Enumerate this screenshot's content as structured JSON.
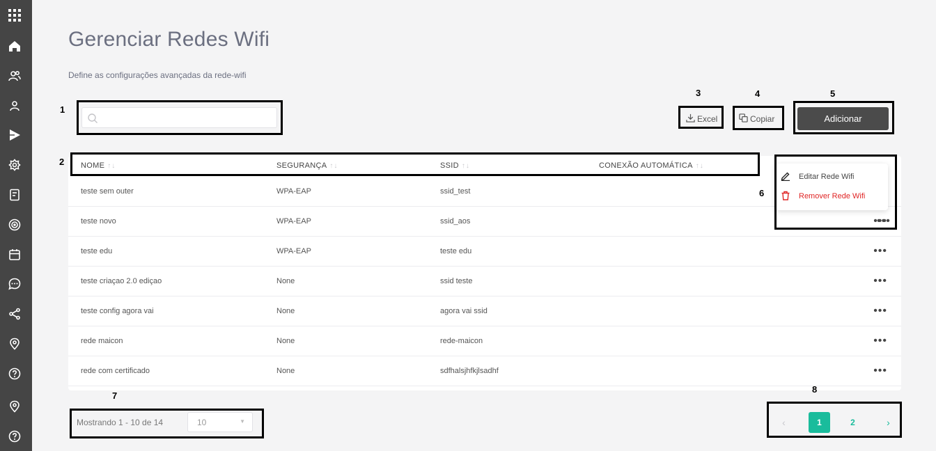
{
  "header": {
    "title": "Gerenciar Redes Wifi",
    "subtitle": "Define as configurações avançadas da rede-wifi"
  },
  "search": {
    "placeholder": "",
    "value": ""
  },
  "toolbar": {
    "excel_label": "Excel",
    "copy_label": "Copiar",
    "add_label": "Adicionar"
  },
  "table": {
    "columns": [
      "NOME",
      "SEGURANÇA",
      "SSID",
      "CONEXÃO AUTOMÁTICA"
    ],
    "rows": [
      {
        "nome": "teste sem outer",
        "seguranca": "WPA-EAP",
        "ssid": "ssid_test",
        "conexao": ""
      },
      {
        "nome": "teste novo",
        "seguranca": "WPA-EAP",
        "ssid": "ssid_aos",
        "conexao": ""
      },
      {
        "nome": "teste edu",
        "seguranca": "WPA-EAP",
        "ssid": "teste edu",
        "conexao": ""
      },
      {
        "nome": "teste criaçao 2.0 ediçao",
        "seguranca": "None",
        "ssid": "ssid teste",
        "conexao": ""
      },
      {
        "nome": "teste config agora vai",
        "seguranca": "None",
        "ssid": "agora vai ssid",
        "conexao": ""
      },
      {
        "nome": "rede maicon",
        "seguranca": "None",
        "ssid": "rede-maicon",
        "conexao": ""
      },
      {
        "nome": "rede com certificado",
        "seguranca": "None",
        "ssid": "sdfhalsjhfkjlsadhf",
        "conexao": ""
      }
    ],
    "row_menu_label": "•••"
  },
  "row_menu": {
    "edit_label": "Editar Rede Wifi",
    "remove_label": "Remover Rede Wifi"
  },
  "pagination": {
    "info": "Mostrando 1 - 10 de 14",
    "page_size": "10",
    "prev": "‹",
    "next": "›",
    "pages": [
      "1",
      "2"
    ],
    "current_page": "1"
  },
  "annotations": [
    "1",
    "2",
    "3",
    "4",
    "5",
    "6",
    "7",
    "8"
  ],
  "colors": {
    "sidebar": "#454545",
    "accent": "#1abc9c",
    "primary_button": "#4b4b4b",
    "danger": "#e02424"
  },
  "sidebar_icons": [
    "apps-grid-icon",
    "home-icon",
    "users-icon",
    "user-icon",
    "play-icon",
    "settings-icon",
    "document-icon",
    "target-icon",
    "calendar-icon",
    "chat-icon",
    "share-icon",
    "location-icon",
    "help-icon",
    "location-icon",
    "help-icon"
  ]
}
